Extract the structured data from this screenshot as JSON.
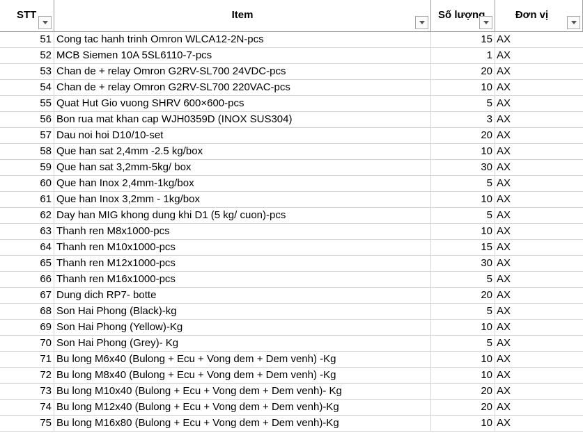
{
  "header": {
    "stt": "STT",
    "item": "Item",
    "qty": "Số lượng",
    "unit": "Đơn vị"
  },
  "rows": [
    {
      "stt": "51",
      "item": "Cong tac hanh trinh Omron WLCA12-2N-pcs",
      "qty": "15",
      "unit": "AX"
    },
    {
      "stt": "52",
      "item": "MCB Siemen 10A 5SL6110-7-pcs",
      "qty": "1",
      "unit": "AX"
    },
    {
      "stt": "53",
      "item": "Chan de + relay Omron G2RV-SL700 24VDC-pcs",
      "qty": "20",
      "unit": "AX"
    },
    {
      "stt": "54",
      "item": "Chan de + relay Omron G2RV-SL700 220VAC-pcs",
      "qty": "10",
      "unit": "AX"
    },
    {
      "stt": "55",
      "item": "Quat Hut Gio vuong SHRV 600×600-pcs",
      "qty": "5",
      "unit": "AX"
    },
    {
      "stt": "56",
      "item": "Bon rua mat khan cap WJH0359D (INOX SUS304)",
      "qty": "3",
      "unit": "AX"
    },
    {
      "stt": "57",
      "item": "Dau noi hoi D10/10-set",
      "qty": "20",
      "unit": "AX"
    },
    {
      "stt": "58",
      "item": "Que han sat 2,4mm -2.5 kg/box",
      "qty": "10",
      "unit": "AX"
    },
    {
      "stt": "59",
      "item": "Que han sat 3,2mm-5kg/ box",
      "qty": "30",
      "unit": "AX"
    },
    {
      "stt": "60",
      "item": "Que han Inox 2,4mm-1kg/box",
      "qty": "5",
      "unit": "AX"
    },
    {
      "stt": "61",
      "item": "Que han Inox 3,2mm - 1kg/box",
      "qty": "10",
      "unit": "AX"
    },
    {
      "stt": "62",
      "item": "Day han MIG khong dung khi D1 (5 kg/ cuon)-pcs",
      "qty": "5",
      "unit": "AX"
    },
    {
      "stt": "63",
      "item": "Thanh ren M8x1000-pcs",
      "qty": "10",
      "unit": "AX"
    },
    {
      "stt": "64",
      "item": "Thanh ren M10x1000-pcs",
      "qty": "15",
      "unit": "AX"
    },
    {
      "stt": "65",
      "item": "Thanh ren M12x1000-pcs",
      "qty": "30",
      "unit": "AX"
    },
    {
      "stt": "66",
      "item": "Thanh ren M16x1000-pcs",
      "qty": "5",
      "unit": "AX"
    },
    {
      "stt": "67",
      "item": "Dung dich RP7- botte",
      "qty": "20",
      "unit": "AX"
    },
    {
      "stt": "68",
      "item": "Son Hai Phong (Black)-kg",
      "qty": "5",
      "unit": "AX"
    },
    {
      "stt": "69",
      "item": "Son Hai Phong (Yellow)-Kg",
      "qty": "10",
      "unit": "AX"
    },
    {
      "stt": "70",
      "item": "Son Hai Phong (Grey)- Kg",
      "qty": "5",
      "unit": "AX"
    },
    {
      "stt": "71",
      "item": "Bu long M6x40 (Bulong + Ecu + Vong dem + Dem venh) -Kg",
      "qty": "10",
      "unit": "AX"
    },
    {
      "stt": "72",
      "item": "Bu long M8x40 (Bulong + Ecu + Vong dem + Dem venh) -Kg",
      "qty": "10",
      "unit": "AX"
    },
    {
      "stt": "73",
      "item": "Bu long M10x40 (Bulong + Ecu + Vong dem + Dem venh)- Kg",
      "qty": "20",
      "unit": "AX"
    },
    {
      "stt": "74",
      "item": "Bu long M12x40 (Bulong + Ecu + Vong dem + Dem venh)-Kg",
      "qty": "20",
      "unit": "AX"
    },
    {
      "stt": "75",
      "item": "Bu long M16x80 (Bulong + Ecu + Vong dem + Dem venh)-Kg",
      "qty": "10",
      "unit": "AX"
    }
  ],
  "icons": {
    "filter": "filter-dropdown-icon"
  }
}
